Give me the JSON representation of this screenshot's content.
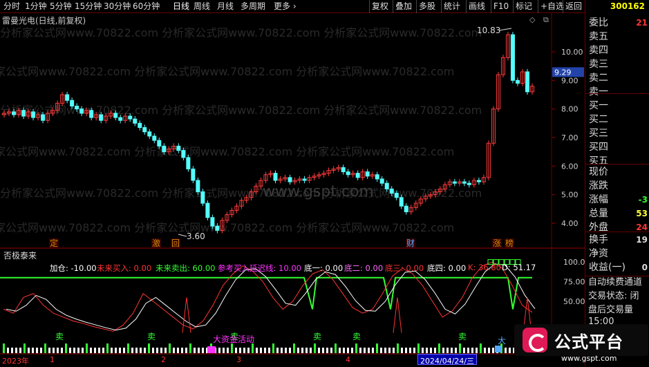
{
  "toolbar": {
    "items": [
      "分时",
      "1分钟",
      "5分钟",
      "15分钟",
      "30分钟",
      "60分钟",
      "日线",
      "周线",
      "月线",
      "多周期",
      "更多 ›"
    ],
    "right_items": [
      "复权",
      "叠加",
      "多股",
      "统计",
      "画线",
      "F10",
      "标记",
      "+自选",
      "返回"
    ]
  },
  "stock_code": "300162",
  "chart_title": "雷曼光电(日线,前复权)",
  "watermark": "分析家公式网www.70822.com",
  "gspt_watermark": "www.gspt.com",
  "price_axis": [
    "10.00",
    "9.00",
    "8.00",
    "7.00",
    "6.00",
    "5.00",
    "4.00"
  ],
  "price_marker": "9.29",
  "high_label": "10.83",
  "low_label": "3.60",
  "event_markers": [
    "定",
    "激",
    "回",
    "财",
    "涨",
    "榜"
  ],
  "indicator": {
    "name": "否极泰来",
    "items": [
      {
        "label": "加仓: -10.00",
        "color": "#ffffff"
      },
      {
        "label": "未来买入: 0.00",
        "color": "#ff3333"
      },
      {
        "label": "未来卖出: 60.00",
        "color": "#33ff33"
      },
      {
        "label": "参考买入延迟线: 10.00",
        "color": "#ff33ff"
      },
      {
        "label": "底一: 0.00",
        "color": "#ffffff"
      },
      {
        "label": "底二: 0.00",
        "color": "#ff66ff"
      },
      {
        "label": "底三: 0.00",
        "color": "#ff3333"
      },
      {
        "label": "底四: 0.00",
        "color": "#ffffff"
      },
      {
        "label": "K: 36.80",
        "color": "#ff3333"
      },
      {
        "label": "D: 51.17",
        "color": "#ffffff"
      }
    ],
    "axis": [
      "100.0",
      "75.00",
      "50.00"
    ],
    "sell_label": "卖",
    "big_label": "大",
    "activity_text": "大资金活动"
  },
  "date_axis": [
    "2023年",
    "1",
    "2",
    "3",
    "4"
  ],
  "current_date": "2024/04/24/三",
  "right_panel": {
    "order_book": [
      {
        "label": "委比",
        "value": "21",
        "color": "#ff3333"
      },
      {
        "label": "卖五",
        "value": "",
        "color": "#ddd"
      },
      {
        "label": "卖四",
        "value": "",
        "color": "#ddd"
      },
      {
        "label": "卖三",
        "value": "",
        "color": "#ddd"
      },
      {
        "label": "卖二",
        "value": "",
        "color": "#ddd"
      },
      {
        "label": "卖一",
        "value": "",
        "color": "#ddd"
      },
      {
        "label": "买一",
        "value": "",
        "color": "#ddd"
      },
      {
        "label": "买二",
        "value": "",
        "color": "#ddd"
      },
      {
        "label": "买三",
        "value": "",
        "color": "#ddd"
      },
      {
        "label": "买四",
        "value": "",
        "color": "#ddd"
      },
      {
        "label": "买五",
        "value": "",
        "color": "#ddd"
      }
    ],
    "quotes": [
      {
        "label": "现价",
        "value": "",
        "color": "#ddd"
      },
      {
        "label": "涨跌",
        "value": "",
        "color": "#ddd"
      },
      {
        "label": "涨幅",
        "value": "-3",
        "color": "#33ff33"
      },
      {
        "label": "总量",
        "value": "53",
        "color": "#ffff33"
      },
      {
        "label": "外盘",
        "value": "24",
        "color": "#ff3333"
      }
    ],
    "extra": [
      {
        "label": "换手",
        "value": "19",
        "color": "#dddddd"
      },
      {
        "label": "净资",
        "value": "",
        "color": "#ddd"
      },
      {
        "label": "收益(一)",
        "value": "0",
        "color": "#dddddd"
      }
    ],
    "service": [
      "自动续费通道",
      "交易状态: 闭",
      "盘后交易量"
    ],
    "time": "15:00"
  },
  "logo": {
    "text": "公式平台",
    "url": "www.gspt.com"
  }
}
